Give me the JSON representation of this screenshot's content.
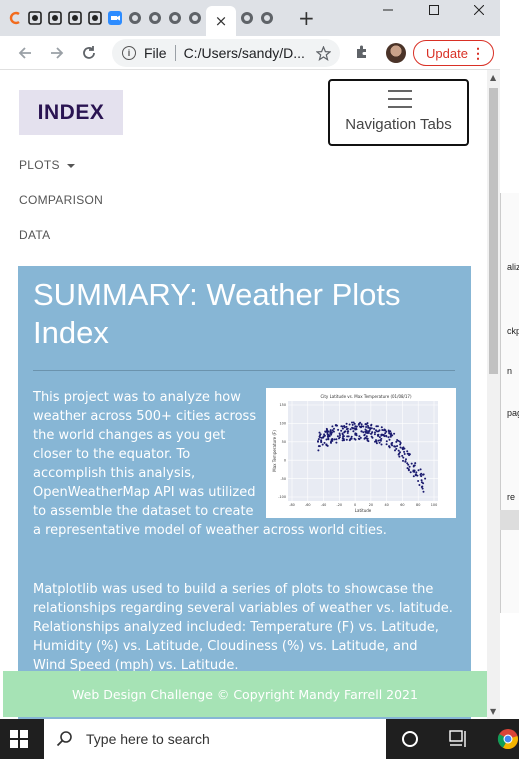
{
  "browser": {
    "url_scheme": "File",
    "url": "C:/Users/sandy/D...",
    "update_label": "Update",
    "close_tab_glyph": "×",
    "new_tab_glyph": "+",
    "accent": "#d93025"
  },
  "site": {
    "brand": "INDEX",
    "menu_toggle_label": "Navigation Tabs",
    "nav": [
      {
        "label": "PLOTS",
        "has_dropdown": true
      },
      {
        "label": "COMPARISON"
      },
      {
        "label": "DATA"
      }
    ],
    "panel_color": "#87b6d5",
    "footer_color": "#a6e3b5"
  },
  "summary": {
    "title": "SUMMARY: Weather Plots Index",
    "para1_lines": [
      "This project was to analyze how",
      "weather across 500+ cities across",
      "the world changes as you get",
      "closer to the equator. To",
      "accomplish this analysis,",
      "OpenWeatherMap API was utilized",
      "to assemble the dataset to create",
      "a representative model of weather across world cities."
    ],
    "para2_lines": [
      "Matplotlib was used to build a series of plots to showcase the",
      "relationships regarding several variables of weather vs. latitude.",
      "Relationships analyzed included: Temperature (F) vs. Latitude,",
      "Humidity (%) vs. Latitude, Cloudiness (%) vs. Latitude, and",
      "Wind Speed (mph) vs. Latitude."
    ],
    "thumbnail": {
      "title": "City Latitude vs. Max Temperature (01/08/17)",
      "xlabel": "Latitude",
      "ylabel": "Max Temperature (F)",
      "yticks": [
        "150",
        "100",
        "50",
        "0",
        "-50",
        "-100"
      ],
      "xticks": [
        "-80",
        "-60",
        "-40",
        "-20",
        "0",
        "20",
        "40",
        "60",
        "80",
        "100"
      ],
      "point_color": "#1a1a6e"
    }
  },
  "footer": {
    "text": "Web Design Challenge © Copyright Mandy Farrell 2021"
  },
  "background_window": {
    "snippets": [
      "aliz",
      "ckp",
      "n",
      "pag",
      "re"
    ]
  },
  "taskbar": {
    "search_placeholder": "Type here to search"
  }
}
